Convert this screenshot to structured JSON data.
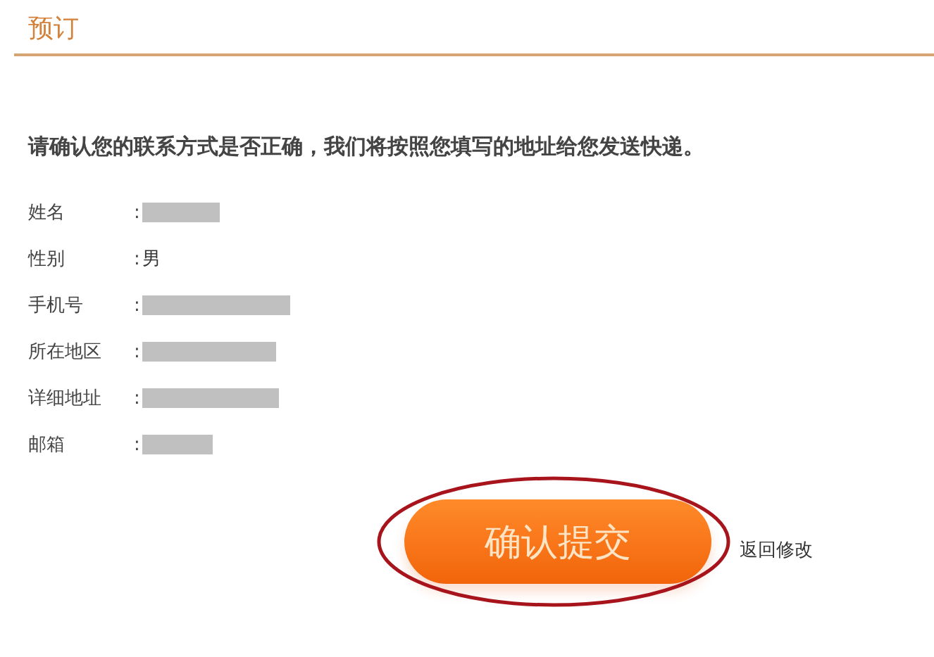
{
  "header": {
    "title": "预订"
  },
  "instruction": "请确认您的联系方式是否正确，我们将按照您填写的地址给您发送快递。",
  "fields": [
    {
      "label": "姓名",
      "separator": ":",
      "kind": "redacted"
    },
    {
      "label": "性别",
      "separator": ":",
      "kind": "text",
      "value": "男"
    },
    {
      "label": "手机号",
      "separator": ":",
      "kind": "redacted"
    },
    {
      "label": "所在地区",
      "separator": ":",
      "kind": "redacted"
    },
    {
      "label": "详细地址",
      "separator": ":",
      "kind": "redacted"
    },
    {
      "label": "邮箱",
      "separator": ":",
      "kind": "redacted"
    }
  ],
  "submit_button": {
    "label": "确认提交",
    "highlighted": true
  },
  "back_link": "返回修改"
}
